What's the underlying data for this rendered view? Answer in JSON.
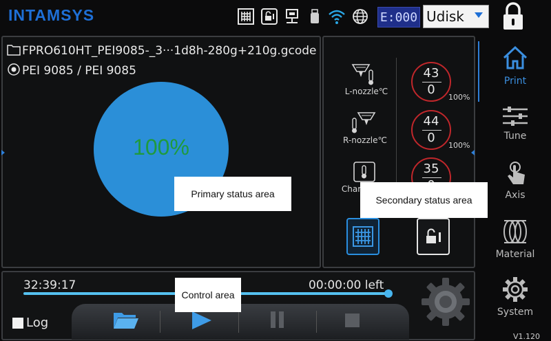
{
  "header": {
    "logo": "INTAMSYS",
    "e_counter": "E:000",
    "storage_select": "Udisk",
    "icons": [
      "grid-icon",
      "lock-card-icon",
      "ethernet-icon",
      "usb-icon",
      "wifi-icon",
      "globe-icon",
      "lock-icon"
    ]
  },
  "primary": {
    "file_name": "FPRO610HT_PEI9085-_3···1d8h-280g+210g.gcode",
    "material": "PEI 9085 / PEI 9085",
    "progress_text": "100%",
    "progress_fraction": 1.0,
    "callout": "Primary status area"
  },
  "secondary": {
    "callout": "Secondary status area",
    "temps": [
      {
        "label": "L-nozzle℃",
        "current": "43",
        "target": "0",
        "percent": "100%"
      },
      {
        "label": "R-nozzle℃",
        "current": "44",
        "target": "0",
        "percent": "100%"
      },
      {
        "label": "Char",
        "current": "35",
        "target": "0",
        "percent": ""
      }
    ]
  },
  "control": {
    "elapsed": "32:39:17",
    "remaining": "00:00:00 left",
    "progress_fraction": 1.0,
    "log_label": "Log",
    "callout": "Control area"
  },
  "nav": {
    "items": [
      {
        "label": "Print",
        "icon": "home-icon"
      },
      {
        "label": "Tune",
        "icon": "sliders-icon"
      },
      {
        "label": "Axis",
        "icon": "hand-icon"
      },
      {
        "label": "Material",
        "icon": "spool-icon"
      },
      {
        "label": "System",
        "icon": "gear-icon"
      }
    ],
    "version": "V1.120"
  },
  "colors": {
    "accent": "#2b8fd8",
    "progress_text": "#1f9a3e",
    "ring": "#c0272b",
    "e_counter_bg": "#1f2f8a"
  }
}
